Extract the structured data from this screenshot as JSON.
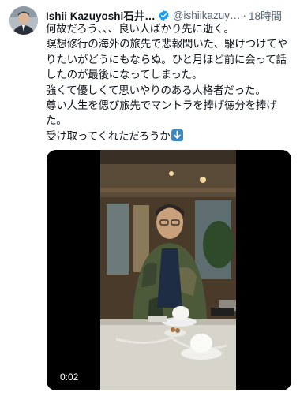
{
  "tweet": {
    "author_name": "Ishii Kazuyoshi石井…",
    "author_handle": "@ishiikazuy…",
    "separator": "·",
    "time_ago": "18時間",
    "verified_icon": "verified-badge",
    "lines": [
      "何故だろう、、、良い人ばかり先に逝く。",
      "瞑想修行の海外の旅先で悲報聞いた、駆けつけてや",
      "りたいがどうにもならぬ。ひと月ほど前に会って話",
      "したのが最後になってしまった。",
      "強くて優しくて思いやりのある人格者だった。",
      "尊い人生を偲び旅先でマントラを捧げ徳分を捧げ",
      "た。",
      "受け取ってくれただろうか"
    ],
    "emoji": "down-arrow-emoji"
  },
  "video": {
    "timestamp": "0:02"
  },
  "colors": {
    "text": "#0f1419",
    "secondary": "#536471",
    "verified": "#1d9bf0",
    "emoji_bg": "#3b88c3"
  }
}
